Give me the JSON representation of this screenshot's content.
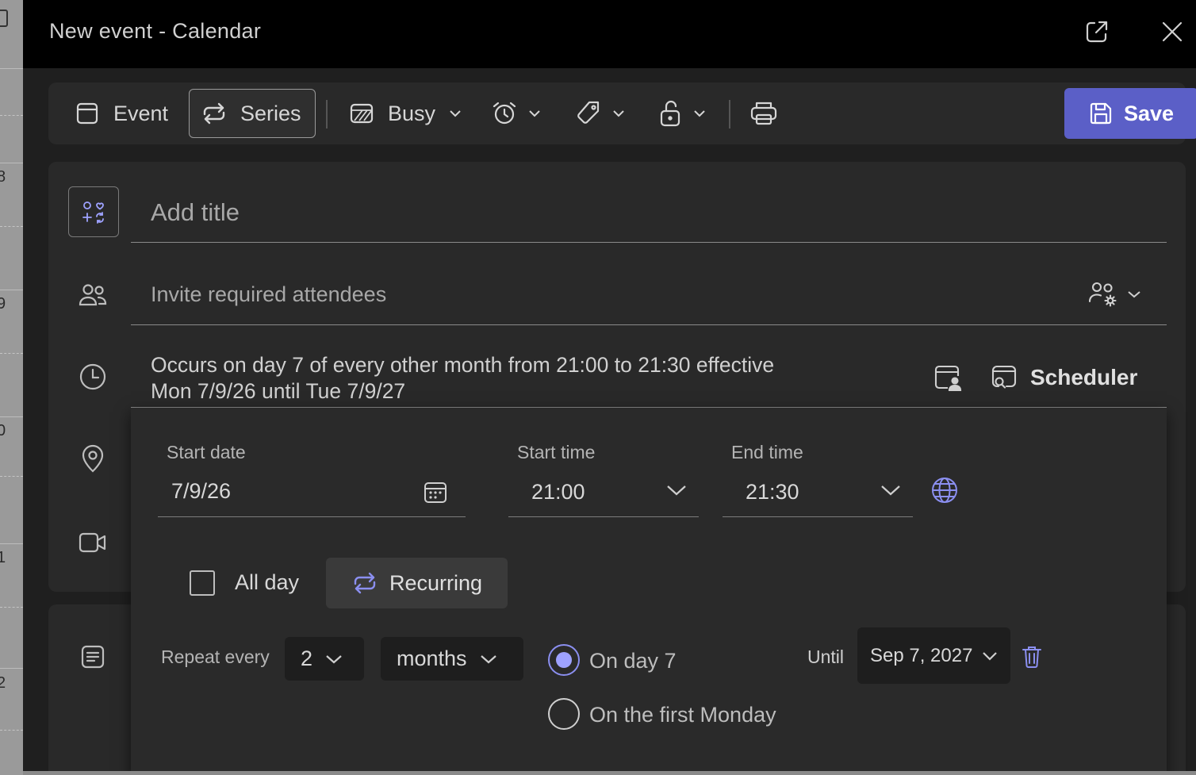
{
  "background": {
    "hour_labels": [
      "8",
      "9",
      "0",
      "1",
      "2"
    ]
  },
  "window": {
    "title": "New event - Calendar"
  },
  "toolbar": {
    "event_label": "Event",
    "series_label": "Series",
    "busy_label": "Busy",
    "save_label": "Save"
  },
  "form": {
    "title_placeholder": "Add title",
    "attendees_placeholder": "Invite required attendees",
    "occurrence_line1": "Occurs on day 7 of every other month from 21:00 to 21:30 effective",
    "occurrence_line2": "Mon 7/9/26 until Tue 7/9/27",
    "scheduler_label": "Scheduler"
  },
  "schedule": {
    "start_date_label": "Start date",
    "start_date_value": "7/9/26",
    "start_time_label": "Start time",
    "start_time_value": "21:00",
    "end_time_label": "End time",
    "end_time_value": "21:30",
    "all_day_label": "All day",
    "recurring_label": "Recurring",
    "repeat_every_label": "Repeat every",
    "repeat_interval": "2",
    "repeat_unit": "months",
    "option_day_label": "On day 7",
    "option_weekday_label": "On the first Monday",
    "until_label": "Until",
    "until_value": "Sep 7, 2027"
  },
  "colors": {
    "accent": "#5b5fc7",
    "accent_light": "#8b8ff0",
    "background": "#1f1f1f",
    "panel": "#292929"
  }
}
